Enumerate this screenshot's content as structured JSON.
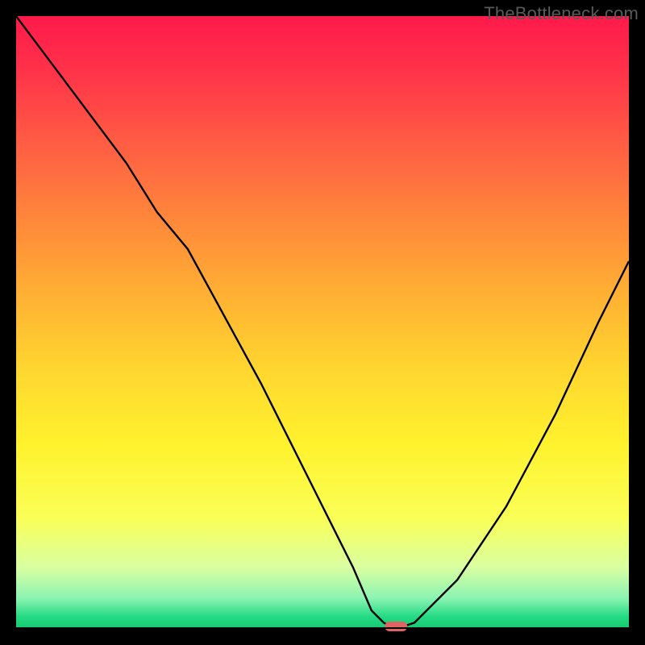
{
  "watermark": "TheBottleneck.com",
  "colors": {
    "frame": "#000000",
    "curve": "#000000",
    "marker": "#e06464",
    "gradient_top": "#ff1a4b",
    "gradient_mid": "#ffd72f",
    "gradient_bottom": "#15c96d"
  },
  "chart_data": {
    "type": "line",
    "title": "",
    "xlabel": "",
    "ylabel": "",
    "xlim": [
      0,
      100
    ],
    "ylim": [
      0,
      100
    ],
    "series": [
      {
        "name": "bottleneck-curve",
        "x": [
          0,
          6,
          12,
          18,
          23,
          28,
          40,
          50,
          55,
          58,
          60,
          62,
          65,
          72,
          80,
          88,
          95,
          100
        ],
        "values": [
          100,
          92,
          84,
          76,
          68,
          62,
          40,
          20,
          10,
          3,
          1,
          0,
          1,
          8,
          20,
          35,
          50,
          60
        ]
      }
    ],
    "annotations": [
      {
        "name": "optimal-marker",
        "x": 62,
        "y": 0,
        "shape": "pill"
      }
    ],
    "grid": false,
    "legend": false,
    "background": "vertical-gradient red→yellow→green (bottleneck severity)"
  }
}
